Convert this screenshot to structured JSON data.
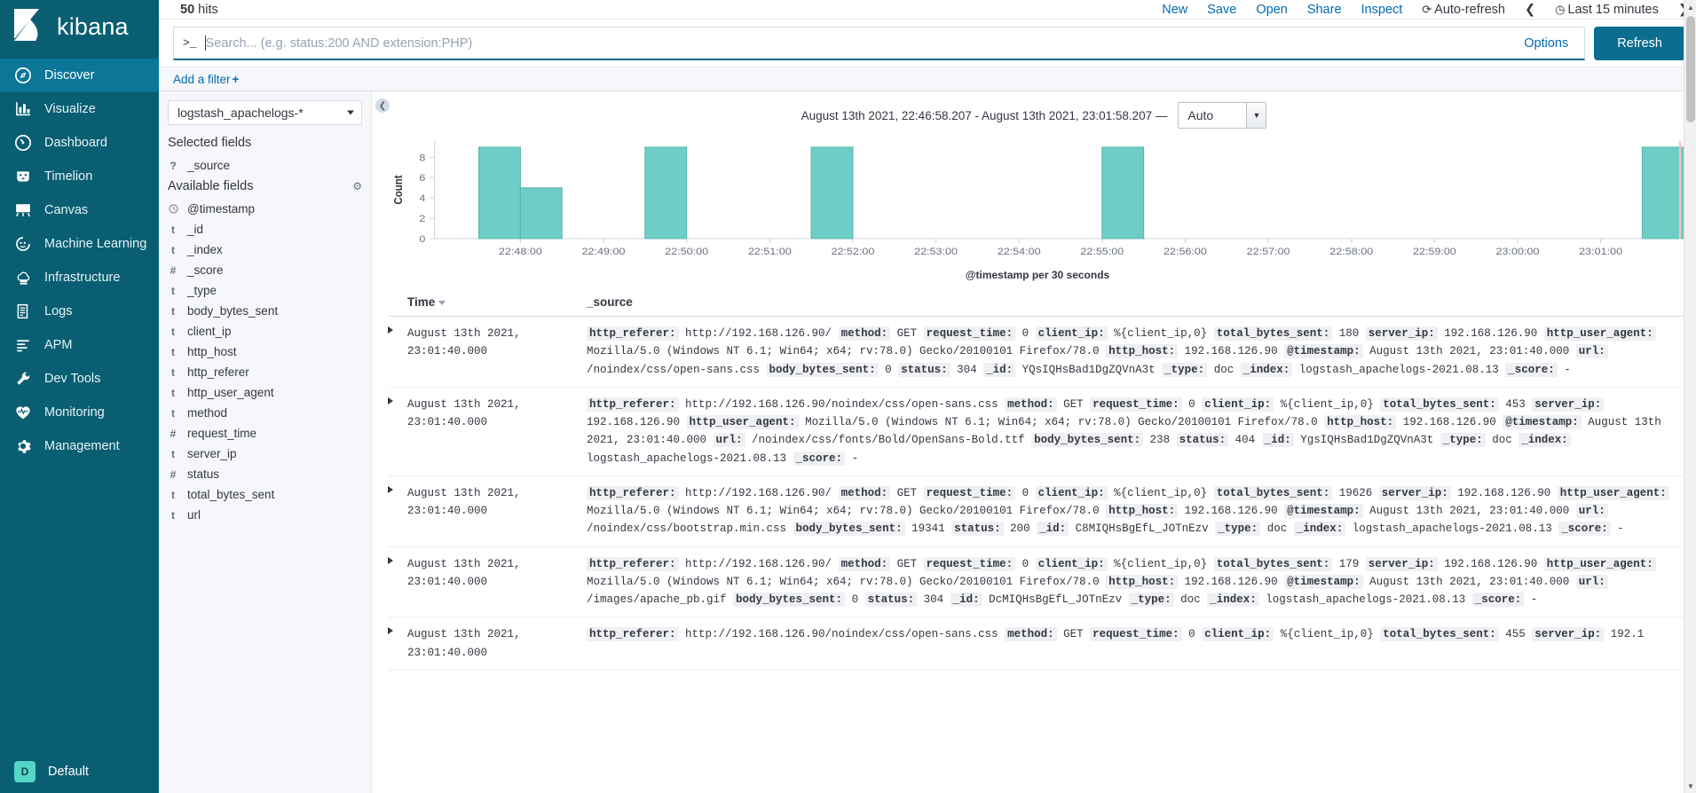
{
  "app": {
    "brand": "kibana",
    "space_label": "Default",
    "space_initial": "D"
  },
  "sidebar": {
    "items": [
      {
        "label": "Discover",
        "icon": "compass-icon",
        "active": true
      },
      {
        "label": "Visualize",
        "icon": "bar-chart-icon",
        "active": false
      },
      {
        "label": "Dashboard",
        "icon": "dashboard-icon",
        "active": false
      },
      {
        "label": "Timelion",
        "icon": "timelion-icon",
        "active": false
      },
      {
        "label": "Canvas",
        "icon": "canvas-icon",
        "active": false
      },
      {
        "label": "Machine Learning",
        "icon": "machine-learning-icon",
        "active": false
      },
      {
        "label": "Infrastructure",
        "icon": "infrastructure-icon",
        "active": false
      },
      {
        "label": "Logs",
        "icon": "logs-icon",
        "active": false
      },
      {
        "label": "APM",
        "icon": "apm-icon",
        "active": false
      },
      {
        "label": "Dev Tools",
        "icon": "wrench-icon",
        "active": false
      },
      {
        "label": "Monitoring",
        "icon": "heartbeat-icon",
        "active": false
      },
      {
        "label": "Management",
        "icon": "gear-icon",
        "active": false
      }
    ]
  },
  "topbar": {
    "hits_count": "50",
    "hits_label": "hits",
    "actions": [
      "New",
      "Save",
      "Open",
      "Share",
      "Inspect"
    ],
    "auto_refresh": "Auto-refresh",
    "time_picker": "Last 15 minutes",
    "prev_arrow": "❮",
    "next_arrow": "❯"
  },
  "query": {
    "prompt": ">_",
    "value": "",
    "placeholder": "Search... (e.g. status:200 AND extension:PHP)",
    "options_label": "Options",
    "refresh_label": "Refresh"
  },
  "filter_bar": {
    "add_filter_label": "Add a filter",
    "plus": "+"
  },
  "fields_panel": {
    "index_pattern": "logstash_apachelogs-*",
    "selected_fields_label": "Selected fields",
    "available_fields_label": "Available fields",
    "selected_fields": [
      {
        "name": "_source",
        "type": "?"
      }
    ],
    "available_fields": [
      {
        "name": "@timestamp",
        "type": "clock"
      },
      {
        "name": "_id",
        "type": "t"
      },
      {
        "name": "_index",
        "type": "t"
      },
      {
        "name": "_score",
        "type": "#"
      },
      {
        "name": "_type",
        "type": "t"
      },
      {
        "name": "body_bytes_sent",
        "type": "t"
      },
      {
        "name": "client_ip",
        "type": "t"
      },
      {
        "name": "http_host",
        "type": "t"
      },
      {
        "name": "http_referer",
        "type": "t"
      },
      {
        "name": "http_user_agent",
        "type": "t"
      },
      {
        "name": "method",
        "type": "t"
      },
      {
        "name": "request_time",
        "type": "#"
      },
      {
        "name": "server_ip",
        "type": "t"
      },
      {
        "name": "status",
        "type": "#"
      },
      {
        "name": "total_bytes_sent",
        "type": "t"
      },
      {
        "name": "url",
        "type": "t"
      }
    ]
  },
  "chart_panel": {
    "range_text": "August 13th 2021, 22:46:58.207 - August 13th 2021, 23:01:58.207 —",
    "interval": "Auto"
  },
  "chart_data": {
    "type": "bar",
    "title": "",
    "xlabel": "@timestamp per 30 seconds",
    "ylabel": "Count",
    "ylim": [
      0,
      9.6
    ],
    "yticks": [
      0,
      2,
      4,
      6,
      8
    ],
    "xticks": [
      "22:48:00",
      "22:49:00",
      "22:50:00",
      "22:51:00",
      "22:52:00",
      "22:53:00",
      "22:54:00",
      "22:55:00",
      "22:56:00",
      "22:57:00",
      "22:58:00",
      "22:59:00",
      "23:00:00",
      "23:01:00"
    ],
    "x_start": "22:46:58.207",
    "x_end": "23:01:58.207",
    "bar_color": "#6ecdc4",
    "bar_stroke": "#5ab9b0",
    "grid": false,
    "legend": "none",
    "categories": [
      "22:47:30",
      "22:48:00",
      "22:49:30",
      "22:51:30",
      "22:55:00",
      "23:01:30"
    ],
    "values": [
      9,
      5,
      9,
      9,
      9,
      9
    ]
  },
  "doc_table": {
    "columns": [
      "Time",
      "_source"
    ],
    "rows": [
      {
        "time": "August 13th 2021, 23:01:40.000",
        "pairs": [
          [
            "http_referer:",
            "http://192.168.126.90/"
          ],
          [
            "method:",
            "GET"
          ],
          [
            "request_time:",
            "0"
          ],
          [
            "client_ip:",
            "%{client_ip,0}"
          ],
          [
            "total_bytes_sent:",
            "180"
          ],
          [
            "server_ip:",
            "192.168.126.90"
          ],
          [
            "http_user_agent:",
            "Mozilla/5.0 (Windows NT 6.1; Win64; x64; rv:78.0) Gecko/20100101 Firefox/78.0"
          ],
          [
            "http_host:",
            "192.168.126.90"
          ],
          [
            "@timestamp:",
            "August 13th 2021, 23:01:40.000"
          ],
          [
            "url:",
            "/noindex/css/open-sans.css"
          ],
          [
            "body_bytes_sent:",
            "0"
          ],
          [
            "status:",
            "304"
          ],
          [
            "_id:",
            "YQsIQHsBad1DgZQVnA3t"
          ],
          [
            "_type:",
            "doc"
          ],
          [
            "_index:",
            "logstash_apachelogs-2021.08.13"
          ],
          [
            "_score:",
            "-"
          ]
        ]
      },
      {
        "time": "August 13th 2021, 23:01:40.000",
        "pairs": [
          [
            "http_referer:",
            "http://192.168.126.90/noindex/css/open-sans.css"
          ],
          [
            "method:",
            "GET"
          ],
          [
            "request_time:",
            "0"
          ],
          [
            "client_ip:",
            "%{client_ip,0}"
          ],
          [
            "total_bytes_sent:",
            "453"
          ],
          [
            "server_ip:",
            "192.168.126.90"
          ],
          [
            "http_user_agent:",
            "Mozilla/5.0 (Windows NT 6.1; Win64; x64; rv:78.0) Gecko/20100101 Firefox/78.0"
          ],
          [
            "http_host:",
            "192.168.126.90"
          ],
          [
            "@timestamp:",
            "August 13th 2021, 23:01:40.000"
          ],
          [
            "url:",
            "/noindex/css/fonts/Bold/OpenSans-Bold.ttf"
          ],
          [
            "body_bytes_sent:",
            "238"
          ],
          [
            "status:",
            "404"
          ],
          [
            "_id:",
            "YgsIQHsBad1DgZQVnA3t"
          ],
          [
            "_type:",
            "doc"
          ],
          [
            "_index:",
            "logstash_apachelogs-2021.08.13"
          ],
          [
            "_score:",
            "-"
          ]
        ]
      },
      {
        "time": "August 13th 2021, 23:01:40.000",
        "pairs": [
          [
            "http_referer:",
            "http://192.168.126.90/"
          ],
          [
            "method:",
            "GET"
          ],
          [
            "request_time:",
            "0"
          ],
          [
            "client_ip:",
            "%{client_ip,0}"
          ],
          [
            "total_bytes_sent:",
            "19626"
          ],
          [
            "server_ip:",
            "192.168.126.90"
          ],
          [
            "http_user_agent:",
            "Mozilla/5.0 (Windows NT 6.1; Win64; x64; rv:78.0) Gecko/20100101 Firefox/78.0"
          ],
          [
            "http_host:",
            "192.168.126.90"
          ],
          [
            "@timestamp:",
            "August 13th 2021, 23:01:40.000"
          ],
          [
            "url:",
            "/noindex/css/bootstrap.min.css"
          ],
          [
            "body_bytes_sent:",
            "19341"
          ],
          [
            "status:",
            "200"
          ],
          [
            "_id:",
            "C8MIQHsBgEfL_JOTnEzv"
          ],
          [
            "_type:",
            "doc"
          ],
          [
            "_index:",
            "logstash_apachelogs-2021.08.13"
          ],
          [
            "_score:",
            "-"
          ]
        ]
      },
      {
        "time": "August 13th 2021, 23:01:40.000",
        "pairs": [
          [
            "http_referer:",
            "http://192.168.126.90/"
          ],
          [
            "method:",
            "GET"
          ],
          [
            "request_time:",
            "0"
          ],
          [
            "client_ip:",
            "%{client_ip,0}"
          ],
          [
            "total_bytes_sent:",
            "179"
          ],
          [
            "server_ip:",
            "192.168.126.90"
          ],
          [
            "http_user_agent:",
            "Mozilla/5.0 (Windows NT 6.1; Win64; x64; rv:78.0) Gecko/20100101 Firefox/78.0"
          ],
          [
            "http_host:",
            "192.168.126.90"
          ],
          [
            "@timestamp:",
            "August 13th 2021, 23:01:40.000"
          ],
          [
            "url:",
            "/images/apache_pb.gif"
          ],
          [
            "body_bytes_sent:",
            "0"
          ],
          [
            "status:",
            "304"
          ],
          [
            "_id:",
            "DcMIQHsBgEfL_JOTnEzv"
          ],
          [
            "_type:",
            "doc"
          ],
          [
            "_index:",
            "logstash_apachelogs-2021.08.13"
          ],
          [
            "_score:",
            "-"
          ]
        ]
      },
      {
        "time": "August 13th 2021, 23:01:40.000",
        "pairs": [
          [
            "http_referer:",
            "http://192.168.126.90/noindex/css/open-sans.css"
          ],
          [
            "method:",
            "GET"
          ],
          [
            "request_time:",
            "0"
          ],
          [
            "client_ip:",
            "%{client_ip,0}"
          ],
          [
            "total_bytes_sent:",
            "455"
          ],
          [
            "server_ip:",
            "192.1"
          ]
        ]
      }
    ]
  }
}
